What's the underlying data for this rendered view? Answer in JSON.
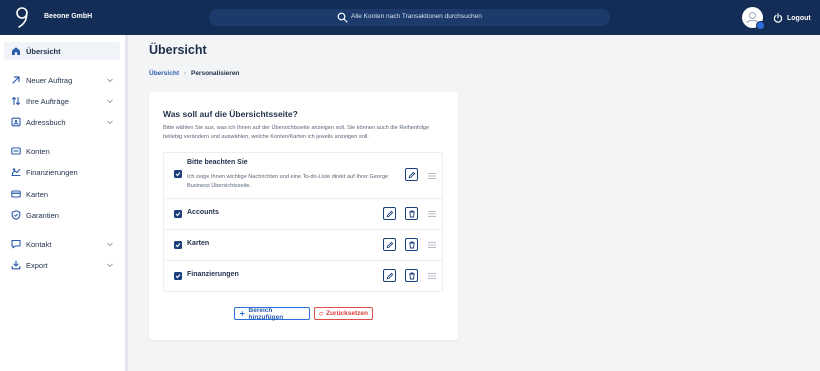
{
  "header": {
    "company": "Beeone GmbH",
    "search_placeholder": "Alle Konten nach Transaktionen durchsuchen",
    "logout_label": "Logout"
  },
  "sidebar": {
    "items": [
      {
        "label": "Übersicht",
        "icon": "home-icon",
        "active": true
      },
      {
        "label": "Neuer Auftrag",
        "icon": "arrow-up-right-icon",
        "expandable": true
      },
      {
        "label": "Ihre Aufträge",
        "icon": "arrows-swap-icon",
        "expandable": true
      },
      {
        "label": "Adressbuch",
        "icon": "contact-card-icon",
        "expandable": true
      },
      {
        "label": "Konten",
        "icon": "account-icon"
      },
      {
        "label": "Finanzierungen",
        "icon": "financing-icon"
      },
      {
        "label": "Karten",
        "icon": "card-icon"
      },
      {
        "label": "Garantien",
        "icon": "shield-icon"
      },
      {
        "label": "Kontakt",
        "icon": "chat-icon",
        "expandable": true
      },
      {
        "label": "Export",
        "icon": "download-icon",
        "expandable": true
      }
    ]
  },
  "main": {
    "title": "Übersicht",
    "breadcrumb": {
      "parent": "Übersicht",
      "current": "Personalisieren"
    }
  },
  "card": {
    "title": "Was soll auf die Übersichtsseite?",
    "description": "Bitte wählen Sie aus, was ich Ihnen auf der Übersichtsseite anzeigen soll. Sie können auch die Reihenfolge beliebig verändern und auswählen, welche Konten/Karten ich jeweils anzeigen soll.",
    "sections": [
      {
        "title": "Bitte beachten Sie",
        "subtitle": "Ich zeige Ihnen wichtige Nachrichten und eine To-do-Liste direkt auf Ihrer George Business Übersichtsseite.",
        "checked": true,
        "deletable": false
      },
      {
        "title": "Accounts",
        "checked": true,
        "deletable": true
      },
      {
        "title": "Karten",
        "checked": true,
        "deletable": true
      },
      {
        "title": "Finanzierungen",
        "checked": true,
        "deletable": true
      }
    ],
    "add_label": "Bereich hinzufügen",
    "reset_label": "Zurücksetzen"
  },
  "colors": {
    "topbar": "#132d56",
    "accent": "#2b6fdc",
    "danger": "#e04b4b",
    "checkbox": "#1b3f7a"
  }
}
